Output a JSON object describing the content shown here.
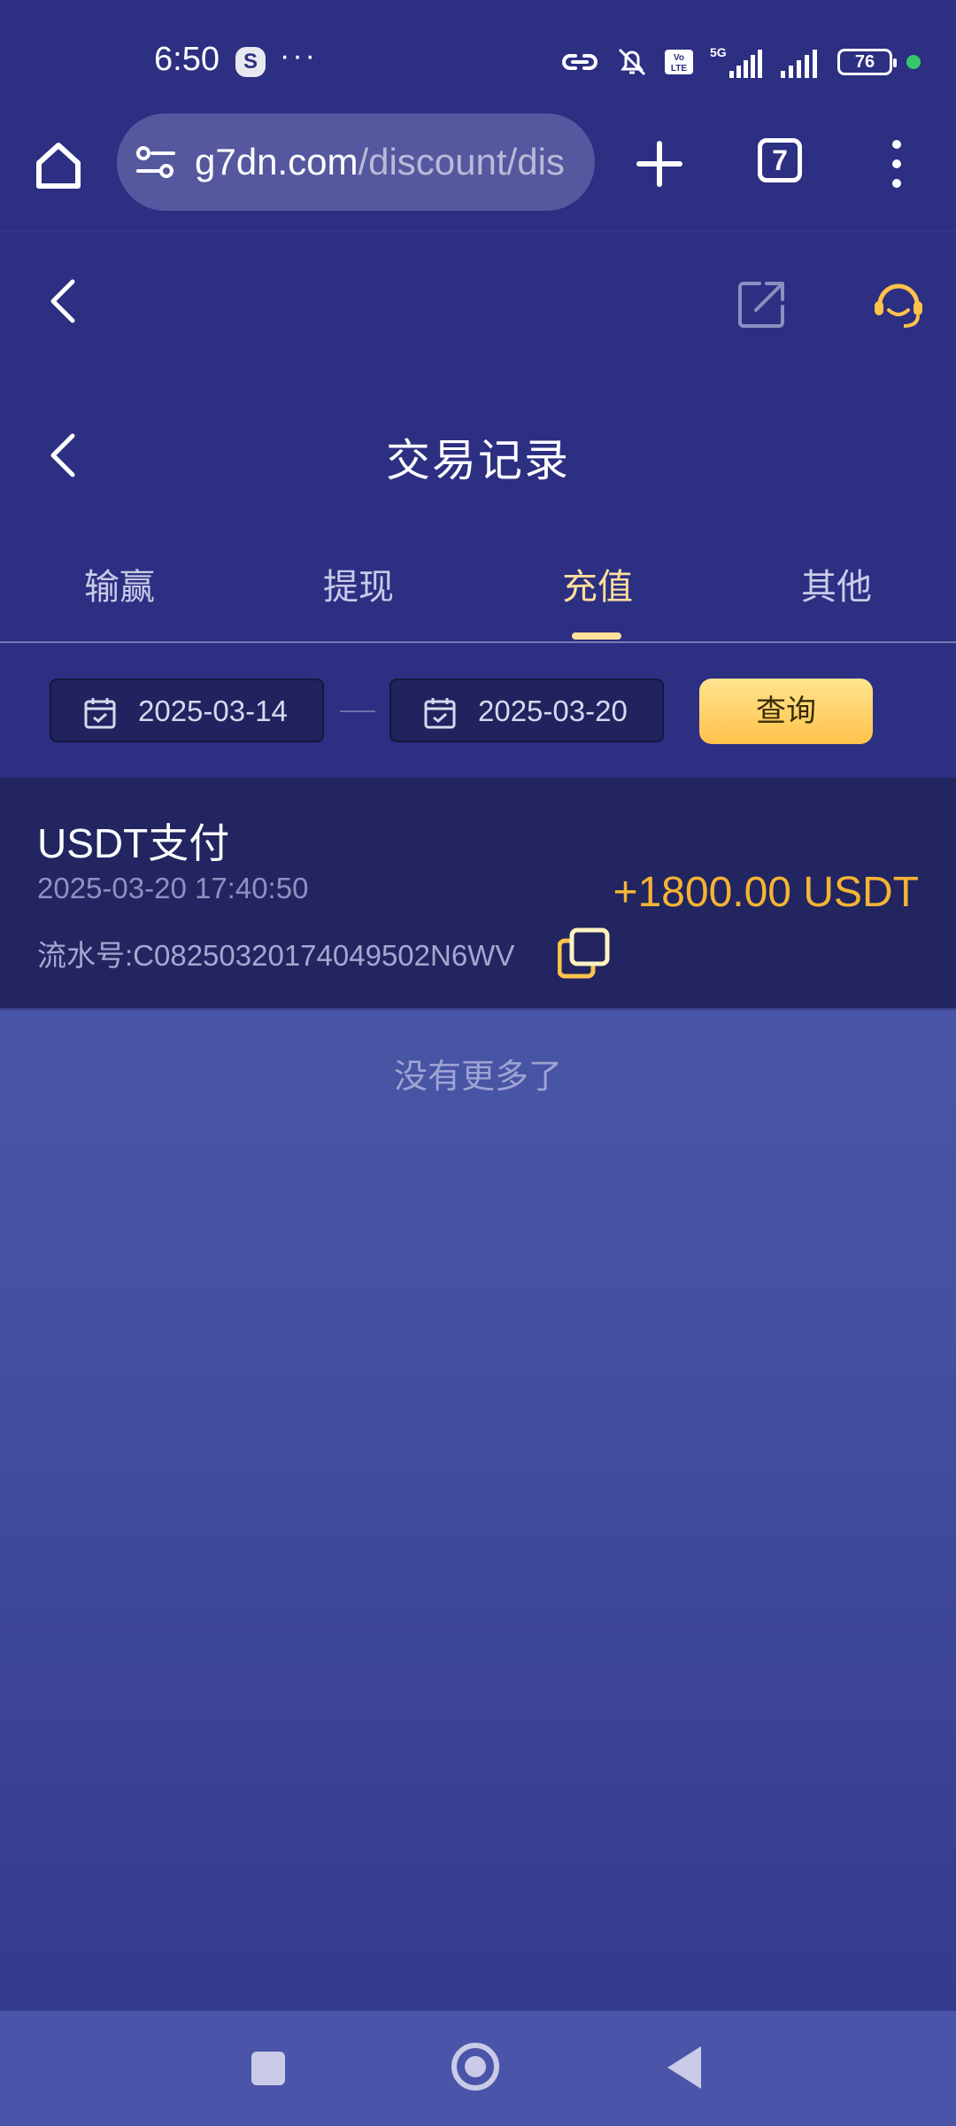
{
  "status_bar": {
    "time": "6:50",
    "app_badge": "S",
    "more_indicator": "···",
    "battery_level": "76",
    "network": "5G"
  },
  "browser": {
    "url_host": "g7dn.com",
    "url_path": "/discount/dis",
    "tab_count": "7"
  },
  "page": {
    "title": "交易记录"
  },
  "tabs": [
    {
      "label": "输赢",
      "active": false
    },
    {
      "label": "提现",
      "active": false
    },
    {
      "label": "充值",
      "active": true
    },
    {
      "label": "其他",
      "active": false
    }
  ],
  "filter": {
    "start_date": "2025-03-14",
    "end_date": "2025-03-20",
    "query_label": "查询"
  },
  "records": [
    {
      "title": "USDT支付",
      "time": "2025-03-20 17:40:50",
      "serial": "流水号:C08250320174049502N6WV",
      "amount": "+1800.00 USDT"
    }
  ],
  "list_footer": "没有更多了",
  "colors": {
    "background": "#2c2f82",
    "accent": "#ffe09b",
    "amount": "#f5b433",
    "query_button": "#ffc24a"
  }
}
